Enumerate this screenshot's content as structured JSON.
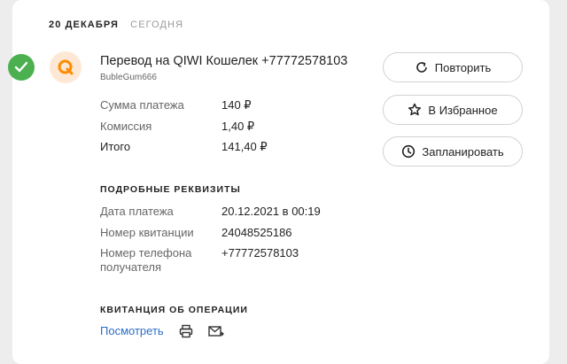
{
  "header": {
    "date": "20 декабря",
    "today": "Сегодня"
  },
  "payment": {
    "title": "Перевод на QIWI Кошелек +77772578103",
    "subtitle": "BubleGum666",
    "status_color": "#4cb050",
    "logo_color": "#ff8c00"
  },
  "amounts": {
    "sum_label": "Сумма платежа",
    "sum_value": "140 ₽",
    "fee_label": "Комиссия",
    "fee_value": "1,40 ₽",
    "total_label": "Итого",
    "total_value": "141,40 ₽"
  },
  "details": {
    "heading": "Подробные реквизиты",
    "date_label": "Дата платежа",
    "date_value": "20.12.2021 в 00:19",
    "receipt_label": "Номер квитанции",
    "receipt_value": "24048525186",
    "phone_label_1": "Номер телефона",
    "phone_label_2": "получателя",
    "phone_value": "+77772578103"
  },
  "receipt": {
    "heading": "Квитанция об операции",
    "view_label": "Посмотреть"
  },
  "actions": {
    "repeat": "Повторить",
    "favorite": "В Избранное",
    "schedule": "Запланировать"
  },
  "colors": {
    "link": "#2a6ec4",
    "success": "#4cb050"
  }
}
